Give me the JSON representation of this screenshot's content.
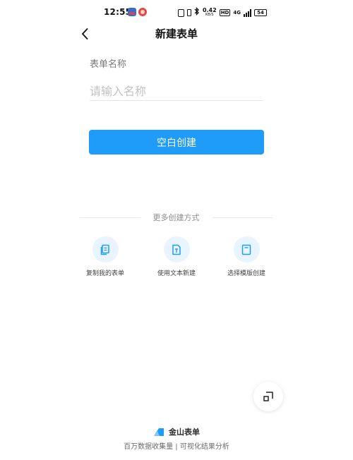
{
  "status_bar": {
    "time": "12:55",
    "net_speed_value": "0.42",
    "net_speed_unit": "KB/S",
    "hd_label": "HD",
    "network_label": "4G",
    "battery": "54"
  },
  "header": {
    "title": "新建表单"
  },
  "form": {
    "name_label": "表单名称",
    "name_value": "",
    "name_placeholder": "请输入名称",
    "blank_create_label": "空白创建"
  },
  "more": {
    "divider_text": "更多创建方式",
    "options": [
      {
        "label": "复制我的表单",
        "icon": "copy-icon"
      },
      {
        "label": "使用文本新建",
        "icon": "text-file-icon"
      },
      {
        "label": "选择模版创建",
        "icon": "template-icon"
      }
    ]
  },
  "footer": {
    "brand_name": "金山表单",
    "slogan": "百万数据收集量 | 可视化结果分析"
  },
  "colors": {
    "accent": "#1f9bf8",
    "icon_bg": "#e8f4ff",
    "brand_icon": "#1f9bf8"
  }
}
